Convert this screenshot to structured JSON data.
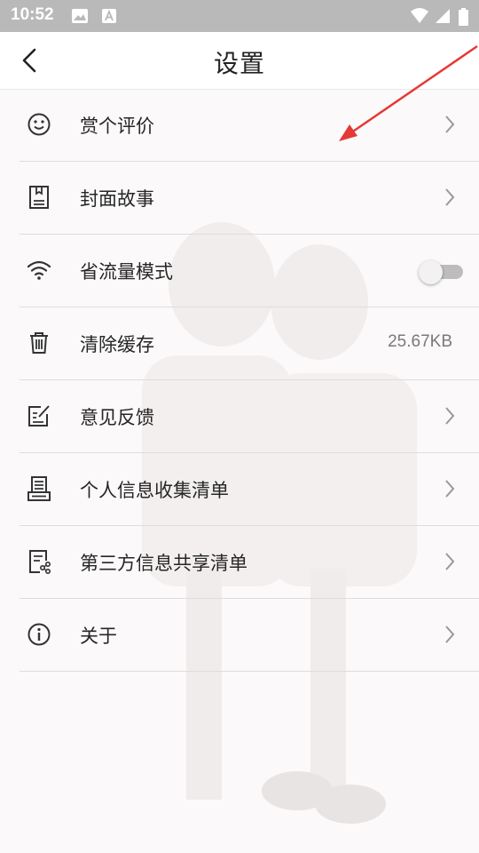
{
  "status_bar": {
    "time": "10:52"
  },
  "header": {
    "title": "设置"
  },
  "settings": [
    {
      "label": "赏个评价",
      "icon": "smiley-icon",
      "trailing": "chevron"
    },
    {
      "label": "封面故事",
      "icon": "bookmark-icon",
      "trailing": "chevron"
    },
    {
      "label": "省流量模式",
      "icon": "wifi-icon",
      "trailing": "toggle",
      "toggle_on": false
    },
    {
      "label": "清除缓存",
      "icon": "trash-icon",
      "trailing": "value",
      "value": "25.67KB"
    },
    {
      "label": "意见反馈",
      "icon": "edit-note-icon",
      "trailing": "chevron"
    },
    {
      "label": "个人信息收集清单",
      "icon": "printer-icon",
      "trailing": "chevron"
    },
    {
      "label": "第三方信息共享清单",
      "icon": "share-document-icon",
      "trailing": "chevron"
    },
    {
      "label": "关于",
      "icon": "info-icon",
      "trailing": "chevron"
    }
  ],
  "colors": {
    "status_bar": "#b9b9b9",
    "annotation_arrow": "#e53935",
    "row_divider": "#e0dcdc"
  }
}
